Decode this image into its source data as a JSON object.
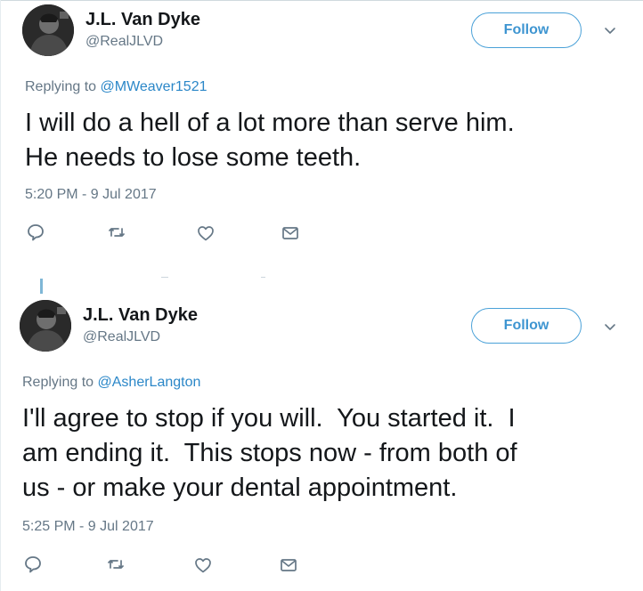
{
  "tweets": [
    {
      "author_name": "J.L. Van Dyke",
      "author_handle": "@RealJLVD",
      "follow_label": "Follow",
      "replying_prefix": "Replying to",
      "replying_to": "@MWeaver1521",
      "text": "I will do a hell of a lot more than serve him.\nHe needs to lose some teeth.",
      "timestamp": "5:20 PM - 9 Jul 2017"
    },
    {
      "author_name": "J.L. Van Dyke",
      "author_handle": "@RealJLVD",
      "follow_label": "Follow",
      "replying_prefix": "Replying to",
      "replying_to": "@AsherLangton",
      "text": "I'll agree to stop if you will.  You started it.  I\nam ending it.  This stops now - from both of\nus - or make your dental appointment.",
      "timestamp": "5:25 PM - 9 Jul 2017"
    }
  ],
  "icons": {
    "reply": "speech-bubble-icon",
    "retweet": "retweet-arrows-icon",
    "like": "heart-icon",
    "dm": "envelope-icon",
    "more": "chevron-down-icon"
  },
  "colors": {
    "follow_border": "#4aa1d8",
    "follow_text": "#3e95d1",
    "mention": "#2b87c8",
    "secondary_text": "#657786",
    "icon_gray": "#657786",
    "thread_line": "#7fb7d6"
  }
}
